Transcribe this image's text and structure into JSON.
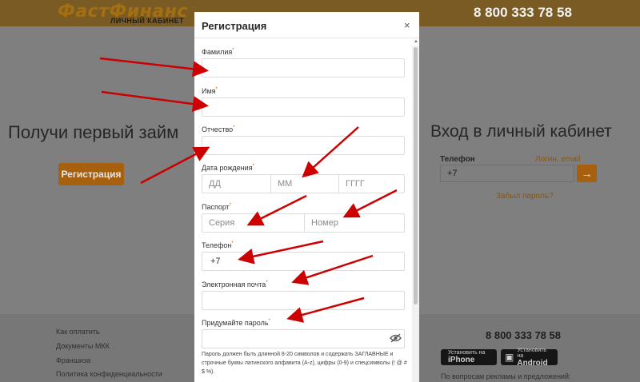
{
  "header": {
    "logo": "ФастФинанс",
    "logo_sub": "ЛИЧНЫЙ КАБИНЕТ",
    "phone": "8 800 333 78 58"
  },
  "left": {
    "title": "Получи первый займ",
    "register_button": "Регистрация"
  },
  "login": {
    "title": "Вход в личный кабинет",
    "phone_label": "Телефон",
    "alt_link": "Логин, email",
    "phone_value": "+7",
    "forgot": "Забыл пароль?"
  },
  "footer": {
    "links": [
      "Как оплатить",
      "Документы МКК",
      "Франшиза",
      "Политика конфиденциальности"
    ],
    "phone": "8 800 333 78 58",
    "ios_top": "Установить на",
    "ios_name": "iPhone",
    "android_top": "Установить на",
    "android_name": "Android",
    "ads": "По вопросам рекламы и предложений:"
  },
  "modal": {
    "title": "Регистрация",
    "close": "×",
    "labels": {
      "surname": "Фамилия",
      "name": "Имя",
      "patronymic": "Отчество",
      "birth": "Дата рождения",
      "passport": "Паспорт",
      "phone": "Телефон",
      "email": "Электронная почта",
      "password": "Придумайте пароль"
    },
    "required_mark": "*",
    "placeholders": {
      "day": "ДД",
      "month": "ММ",
      "year": "ГГГГ",
      "series": "Серия",
      "number": "Номер"
    },
    "phone_value": "+7",
    "password_hint": "Пароль должен быть длинной 8-20 символов и содержать ЗАГЛАВНЫЕ и строчные буквы латинского алфавита (A-z), цифры (0-9) и спецсимволы (! @ # $ %)."
  },
  "colors": {
    "accent": "#f0a12b",
    "arrow": "#cc0000"
  }
}
